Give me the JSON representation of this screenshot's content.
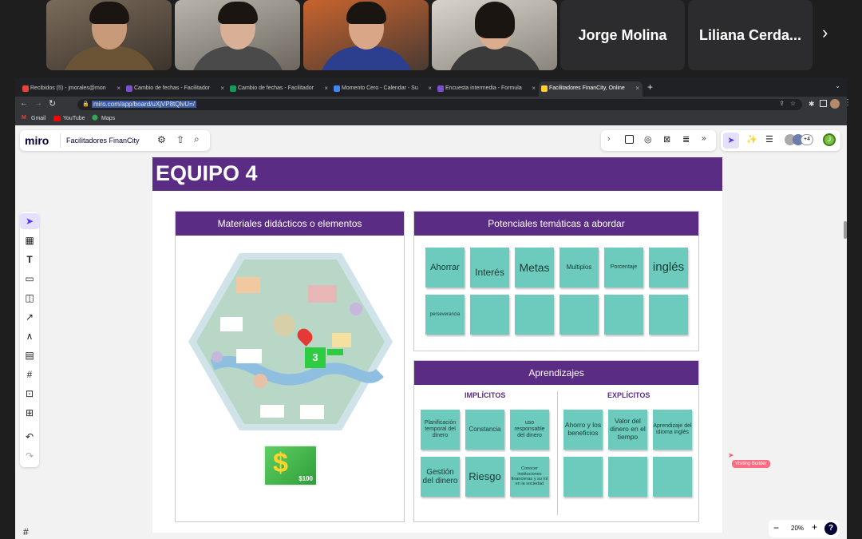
{
  "meeting": {
    "participant_names": [
      "Jorge Molina",
      "Liliana Cerda..."
    ]
  },
  "browser": {
    "tabs": [
      {
        "label": "Recibidos (5) - jmorales@mon",
        "color": "#ea4335"
      },
      {
        "label": "Cambio de fechas - Facilitador",
        "color": "#7b4fd1"
      },
      {
        "label": "Cambio de fechas - Facilitador",
        "color": "#0f9d58"
      },
      {
        "label": "Momento Cero - Calendar - Su",
        "color": "#4285f4"
      },
      {
        "label": "Encuesta intermedia - Formula",
        "color": "#7b4fd1"
      },
      {
        "label": "Facilitadores FinanCity, Online",
        "color": "#ffd02f"
      }
    ],
    "url": "miro.com/app/board/uXjVP8tQlvU=/",
    "bookmarks": [
      "Gmail",
      "YouTube",
      "Maps"
    ]
  },
  "miro": {
    "logo": "miro",
    "board_name": "Facilitadores FinanCity",
    "collab_count": "+4",
    "zoom": "20%",
    "help": "?",
    "cursor_label": "Visiting Builder"
  },
  "board": {
    "team_title": "EQUIPO 4",
    "materials_title": "Materiales didácticos o elementos",
    "topics_title": "Potenciales temáticas a abordar",
    "topics_notes": [
      "Ahorrar",
      "Interés",
      "Metas",
      "Multiplos",
      "Porcentaje",
      "inglés",
      "perseverancia",
      "",
      "",
      "",
      "",
      ""
    ],
    "learning_title": "Aprendizajes",
    "implicit_label": "IMPLÍCITOS",
    "explicit_label": "EXPLÍCITOS",
    "implicit_notes": [
      "Planificación temporal del dinero",
      "Constancia",
      "uso responsable del dinero",
      "Gestión del dinero",
      "Riesgo",
      "Conocer instituciones financieras y su rol en la sociedad"
    ],
    "explicit_notes": [
      "Ahorro y los beneficios",
      "Valor del dinero en el tiempo",
      "Aprendizaje del idioma inglés",
      "",
      "",
      ""
    ],
    "card_amount": "$100",
    "card_number": "3"
  }
}
